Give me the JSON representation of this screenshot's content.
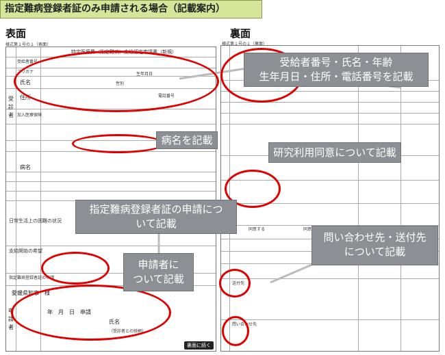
{
  "header": {
    "title": "指定難病登録者証のみ申請される場合（記載案内）"
  },
  "front": {
    "label": "表面",
    "form_number": "様式第１号の１（表面）",
    "form_title": "特定医療費（指定難病）支給認定申請書（新規）",
    "fields": {
      "recipient_no": "受給者番号",
      "furigana": "フリガナ",
      "name": "氏名",
      "birthdate": "生年月日",
      "sex": "性別",
      "address": "住所",
      "phone": "電話番号",
      "applicant_section": "受診者",
      "insurer_section": "加入医療保険",
      "disease": "病名",
      "daily_life": "日常生活上の困難の状況",
      "start_date": "支給開始の希望",
      "registration": "指定難病登録者証の申請",
      "applicant": "申請者",
      "applicant_name": "氏名",
      "relation": "（受診者との続柄）",
      "date_line": "年　月　日　申請",
      "governor": "愛媛県知事　様"
    },
    "next_button": "裏面に続く"
  },
  "back": {
    "label": "裏面",
    "form_number": "様式第１号の１（裏面）",
    "sections": {
      "contact": "問い合わせ先",
      "send_to": "送付先",
      "consent": "同意する",
      "no_consent": "同意しない"
    }
  },
  "callouts": [
    {
      "lines": [
        "受給者番号・氏名・年齢",
        "生年月日・住所・電話番号を記載"
      ]
    },
    {
      "lines": [
        "病名を記載"
      ]
    },
    {
      "lines": [
        "研究利用同意について記載"
      ]
    },
    {
      "lines": [
        "指定難病登録者証の申請につ",
        "いて記載"
      ]
    },
    {
      "lines": [
        "申請者に",
        "ついて記載"
      ]
    },
    {
      "lines": [
        "問い合わせ先・送付先",
        "について記載"
      ]
    }
  ],
  "colors": {
    "callout": "#8c9094",
    "ellipse": "#e00000",
    "title_bg": "#d6e59a"
  }
}
